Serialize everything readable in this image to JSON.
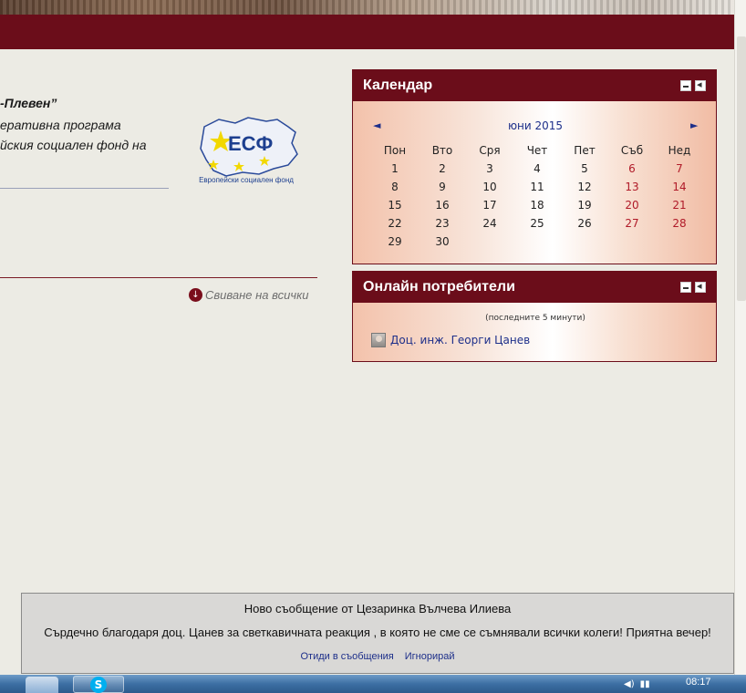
{
  "intro": {
    "title": "-Плевен”",
    "lines": [
      "еративна програма",
      "йския социален фонд на"
    ]
  },
  "esf_logo": {
    "text": "ЕСФ",
    "caption": "Европейски социален фонд"
  },
  "collapse_all": {
    "label": "Свиване на всички",
    "icon": "arrow-down-circle-icon"
  },
  "calendar": {
    "title": "Календар",
    "prev": "◄",
    "next": "►",
    "month": "юни 2015",
    "weekdays": [
      "Пон",
      "Вто",
      "Сря",
      "Чет",
      "Пет",
      "Съб",
      "Нед"
    ],
    "weeks": [
      [
        "1",
        "2",
        "3",
        "4",
        "5",
        "6",
        "7"
      ],
      [
        "8",
        "9",
        "10",
        "11",
        "12",
        "13",
        "14"
      ],
      [
        "15",
        "16",
        "17",
        "18",
        "19",
        "20",
        "21"
      ],
      [
        "22",
        "23",
        "24",
        "25",
        "26",
        "27",
        "28"
      ],
      [
        "29",
        "30",
        "",
        "",
        "",
        "",
        ""
      ]
    ]
  },
  "online_users": {
    "title": "Онлайн потребители",
    "note": "(последните 5 минути)",
    "users": [
      {
        "name": "Доц. инж. Георги Цанев"
      }
    ]
  },
  "notification": {
    "title": "Ново съобщение от Цезаринка Вълчева Илиева",
    "message": "Сърдечно благодаря доц. Цанев за светкавичната реакция , в която не сме се съмнявали всички колеги! Приятна вечер!",
    "link_go": "Отиди в съобщения",
    "link_ignore": "Игнорирай"
  },
  "taskbar": {
    "skype_glyph": "S",
    "clock": "08:17"
  },
  "colors": {
    "brand": "#6b0d1a",
    "link": "#1d2f8a",
    "weekend": "#b01a28"
  }
}
